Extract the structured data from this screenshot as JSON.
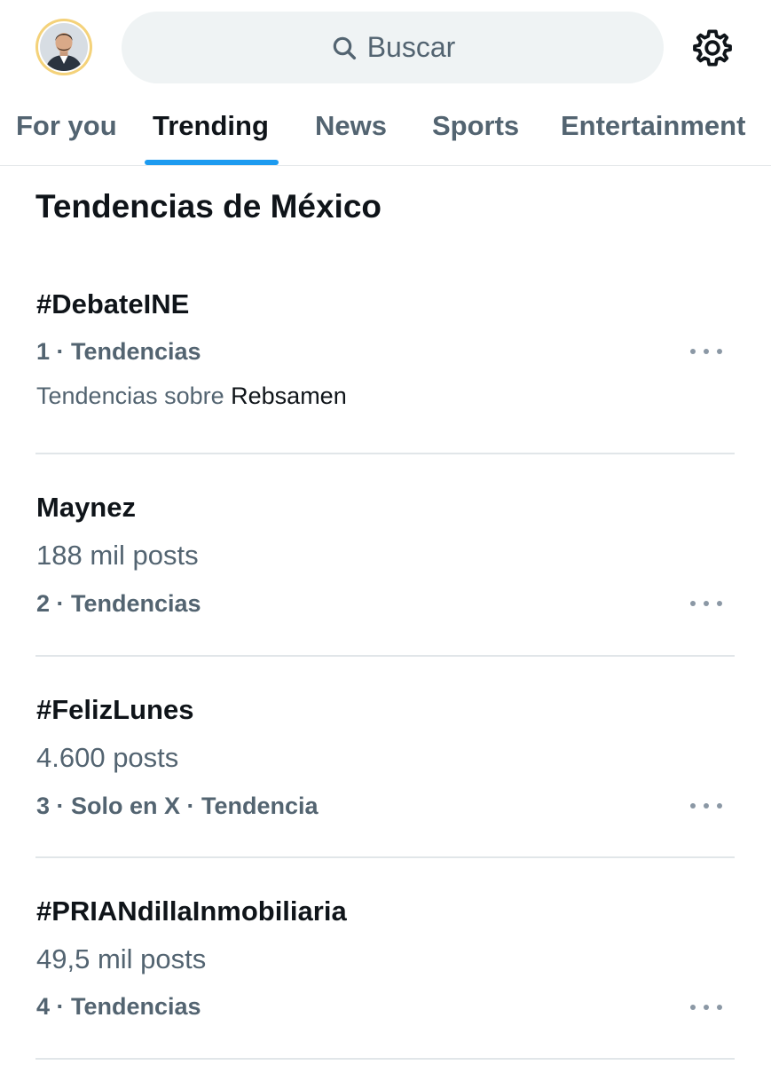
{
  "header": {
    "avatar_icon": "profile-photo",
    "search_placeholder": "Buscar",
    "search_icon": "search-icon",
    "settings_icon": "gear-icon"
  },
  "tabs": [
    {
      "label": "For you",
      "active": false
    },
    {
      "label": "Trending",
      "active": true
    },
    {
      "label": "News",
      "active": false
    },
    {
      "label": "Sports",
      "active": false
    },
    {
      "label": "Entertainment",
      "active": false
    }
  ],
  "section_title": "Tendencias de México",
  "trends": [
    {
      "name": "#DebateINE",
      "meta": "1 · Tendencias",
      "about_prefix": "Tendencias sobre ",
      "about_topic": "Rebsamen"
    },
    {
      "name": "Maynez",
      "posts": "188 mil posts",
      "meta": "2 · Tendencias"
    },
    {
      "name": "#FelizLunes",
      "posts": "4.600 posts",
      "meta": "3 · Solo en X · Tendencia"
    },
    {
      "name": "#PRIANdillaInmobiliaria",
      "posts": "49,5 mil posts",
      "meta": "4 · Tendencias"
    }
  ],
  "colors": {
    "accent": "#1d9bf0",
    "primary_text": "#0f1419",
    "secondary_text": "#536471",
    "search_bg": "#eff3f4"
  }
}
